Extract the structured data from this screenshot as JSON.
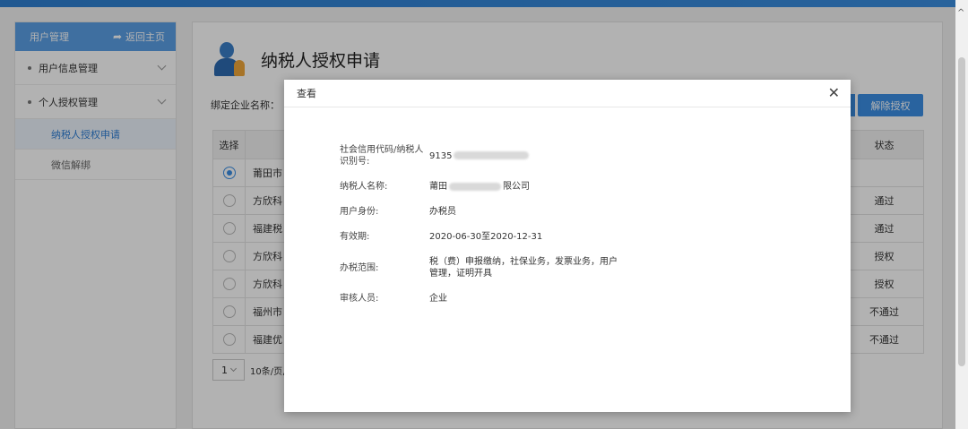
{
  "sidebar": {
    "header_title": "用户管理",
    "back_label": "返回主页",
    "groups": [
      {
        "label": "用户信息管理"
      },
      {
        "label": "个人授权管理"
      }
    ],
    "sub_items": [
      {
        "label": "纳税人授权申请",
        "active": true
      },
      {
        "label": "微信解绑",
        "active": false
      }
    ]
  },
  "main": {
    "title": "纳税人授权申请",
    "filter_label": "绑定企业名称：",
    "unbind_label": "解除授权",
    "table": {
      "headers": [
        "选择",
        "状态"
      ],
      "rows": [
        {
          "name": "莆田市",
          "status": "",
          "selected": true
        },
        {
          "name": "方欣科",
          "status": "通过",
          "selected": false
        },
        {
          "name": "福建税",
          "status": "通过",
          "selected": false
        },
        {
          "name": "方欣科",
          "status": "授权",
          "selected": false
        },
        {
          "name": "方欣科",
          "status": "授权",
          "selected": false
        },
        {
          "name": "福州市",
          "status": "不通过",
          "selected": false
        },
        {
          "name": "福建优",
          "status": "不通过",
          "selected": false
        }
      ]
    },
    "pager": {
      "page": "1",
      "size_text": "10条/页,"
    }
  },
  "dialog": {
    "title": "查看",
    "close_glyph": "✕",
    "fields": [
      {
        "key": "社会信用代码/纳税人识别号:",
        "value": "9135"
      },
      {
        "key": "纳税人名称:",
        "value": "莆田",
        "value_suffix": "限公司"
      },
      {
        "key": "用户身份:",
        "value": "办税员"
      },
      {
        "key": "有效期:",
        "value": "2020-06-30至2020-12-31"
      },
      {
        "key": "办税范围:",
        "value": "税（费）申报缴纳，社保业务，发票业务，用户管理，证明开具"
      },
      {
        "key": "审核人员:",
        "value": "企业"
      }
    ]
  },
  "colors": {
    "accent": "#3c8fe4",
    "sidebar_header": "#5b9fe6",
    "active_text": "#2f7fd6"
  }
}
